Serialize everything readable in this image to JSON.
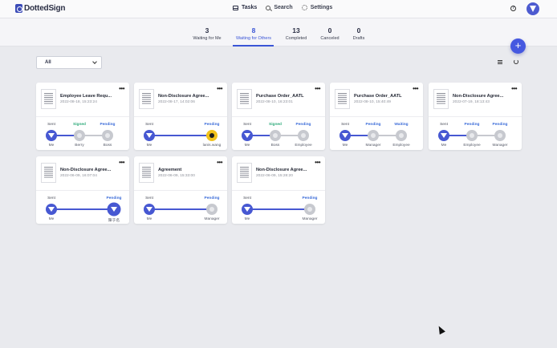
{
  "app": {
    "name": "DottedSign"
  },
  "nav": {
    "tasks": "Tasks",
    "search": "Search",
    "settings": "Settings"
  },
  "stats": [
    {
      "count": "3",
      "label": "Waiting for Me"
    },
    {
      "count": "8",
      "label": "Waiting for Others"
    },
    {
      "count": "13",
      "label": "Completed"
    },
    {
      "count": "0",
      "label": "Canceled"
    },
    {
      "count": "0",
      "label": "Drafts"
    }
  ],
  "active_tab": "Waiting for Others",
  "filter": {
    "value": "All"
  },
  "colors": {
    "accent": "#3a55d6",
    "signed": "#2eaa7a",
    "pending": "#3a6bd8",
    "avatar": "#4758d2"
  },
  "cards": [
    {
      "title": "Employee Leave Requ...",
      "date": "2022-08-18, 15:23:24",
      "signers": [
        {
          "status": "Sent",
          "name": "Me",
          "kind": "me"
        },
        {
          "status": "Signed",
          "name": "Berry",
          "kind": "pending"
        },
        {
          "status": "Pending",
          "name": "Boss",
          "kind": "pending"
        }
      ]
    },
    {
      "title": "Non-Disclosure Agree...",
      "date": "2022-08-17, 14:02:06",
      "signers": [
        {
          "status": "Sent",
          "name": "Me",
          "kind": "me"
        },
        {
          "status": "Pending",
          "name": "lanis.wang",
          "kind": "yellow"
        }
      ]
    },
    {
      "title": "Purchase Order_AATL",
      "date": "2022-08-10, 16:23:01",
      "signers": [
        {
          "status": "Sent",
          "name": "Me",
          "kind": "me"
        },
        {
          "status": "Signed",
          "name": "Boss",
          "kind": "pending"
        },
        {
          "status": "Pending",
          "name": "Employee",
          "kind": "pending"
        }
      ]
    },
    {
      "title": "Purchase Order_AATL",
      "date": "2022-08-10, 15:40:49",
      "signers": [
        {
          "status": "Sent",
          "name": "Me",
          "kind": "me"
        },
        {
          "status": "Pending",
          "name": "Manager",
          "kind": "pending"
        },
        {
          "status": "Waiting",
          "name": "Employee",
          "kind": "pending"
        }
      ]
    },
    {
      "title": "Non-Disclosure Agree...",
      "date": "2022-07-19, 18:13:43",
      "signers": [
        {
          "status": "Sent",
          "name": "Me",
          "kind": "me"
        },
        {
          "status": "Pending",
          "name": "Employee",
          "kind": "pending"
        },
        {
          "status": "Pending",
          "name": "Manager",
          "kind": "pending"
        }
      ]
    },
    {
      "title": "Non-Disclosure Agree...",
      "date": "2022-06-09, 16:07:04",
      "signers": [
        {
          "status": "Sent",
          "name": "Me",
          "kind": "me"
        },
        {
          "status": "Pending",
          "name": "陳于名",
          "kind": "me-ring"
        }
      ]
    },
    {
      "title": "Agreement",
      "date": "2022-06-09, 15:33:00",
      "signers": [
        {
          "status": "Sent",
          "name": "Me",
          "kind": "me"
        },
        {
          "status": "Pending",
          "name": "Manager",
          "kind": "pending"
        }
      ]
    },
    {
      "title": "Non-Disclosure Agree...",
      "date": "2022-06-09, 15:28:20",
      "signers": [
        {
          "status": "Sent",
          "name": "Me",
          "kind": "me"
        },
        {
          "status": "Pending",
          "name": "Manager",
          "kind": "pending"
        }
      ]
    }
  ]
}
